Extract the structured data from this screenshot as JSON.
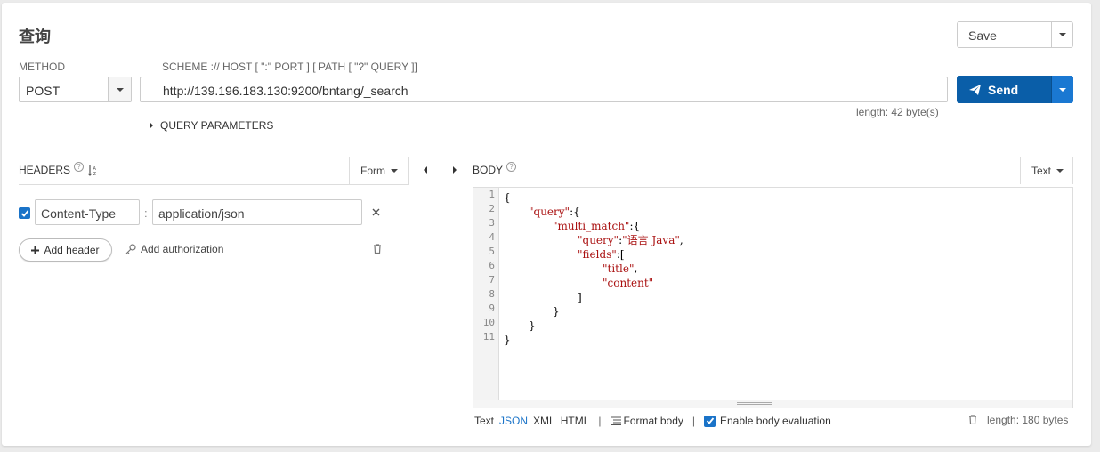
{
  "page": {
    "title": "查询"
  },
  "save": {
    "label": "Save"
  },
  "method": {
    "label": "METHOD",
    "value": "POST"
  },
  "url": {
    "label": "SCHEME :// HOST [ \":\" PORT ] [ PATH [ \"?\" QUERY ]]",
    "value": "http://139.196.183.130:9200/bntang/_search",
    "length": "length: 42 byte(s)"
  },
  "send": {
    "label": "Send"
  },
  "query_params": {
    "label": "QUERY PARAMETERS"
  },
  "headers": {
    "title": "HEADERS",
    "mode": "Form",
    "items": [
      {
        "enabled": true,
        "name": "Content-Type",
        "value": "application/json"
      }
    ],
    "add_header": "Add header",
    "add_authorization": "Add authorization"
  },
  "body": {
    "title": "BODY",
    "mode": "Text",
    "line_numbers": [
      "1",
      "2",
      "3",
      "4",
      "5",
      "6",
      "7",
      "8",
      "9",
      "10",
      "11"
    ],
    "code": {
      "l1": "{",
      "l2k": "\"query\"",
      "l2r": ":{",
      "l3k": "\"multi_match\"",
      "l3r": ":{",
      "l4k": "\"query\"",
      "l4m": ":",
      "l4v": "\"语言 Java\"",
      "l4r": ",",
      "l5k": "\"fields\"",
      "l5r": ":[",
      "l6v": "\"title\"",
      "l6r": ",",
      "l7v": "\"content\"",
      "l8": "]",
      "l9": "}",
      "l10": "}",
      "l11": "}"
    },
    "footer": {
      "formats": [
        "Text",
        "JSON",
        "XML",
        "HTML"
      ],
      "active_format": "JSON",
      "format_body": "Format body",
      "enable_eval": "Enable body evaluation",
      "length": "length: 180 bytes"
    }
  },
  "colors": {
    "primary": "#0a5ea8",
    "primary_light": "#1a78d2",
    "link": "#1a73c8",
    "code_key": "#aa1111"
  }
}
